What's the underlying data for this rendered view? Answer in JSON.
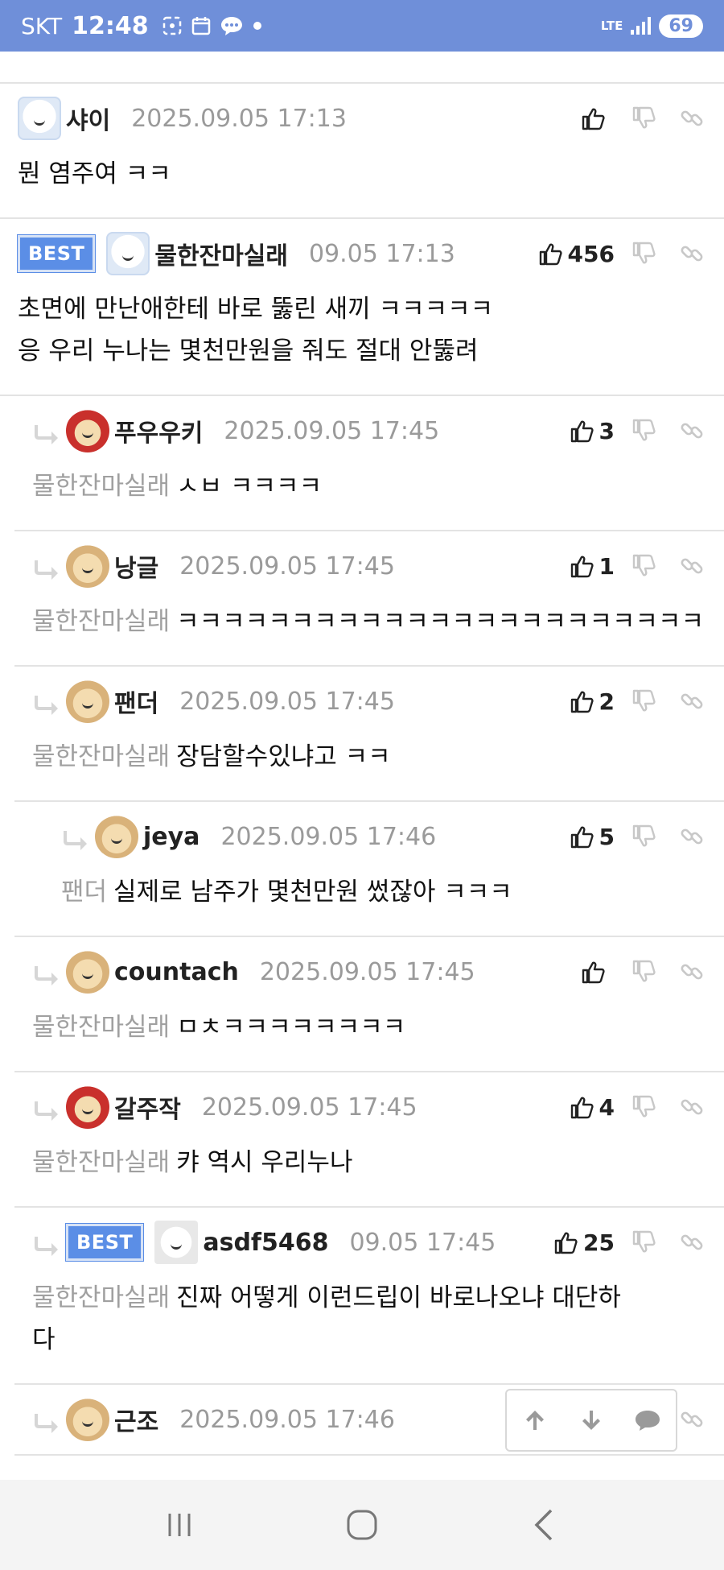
{
  "status_bar": {
    "carrier": "SKT",
    "time": "12:48",
    "network": "LTE",
    "battery": "69"
  },
  "comments": [
    {
      "nick": "샤이",
      "date": "2025.09.05 17:13",
      "likes": "",
      "best": false,
      "reply": false,
      "mention": "",
      "text": "뭔 염주여 ㅋㅋ",
      "avatar": "bear"
    },
    {
      "nick": "물한잔마실래",
      "date": "09.05 17:13",
      "likes": "456",
      "best": true,
      "best_label": "BEST",
      "reply": false,
      "mention": "",
      "text_lines": [
        "초면에 만난애한테 바로 뚫린 새끼 ㅋㅋㅋㅋㅋ",
        "응 우리 누나는 몇천만원을 줘도 절대 안뚫려"
      ],
      "avatar": "bear"
    },
    {
      "nick": "푸우우키",
      "date": "2025.09.05 17:45",
      "likes": "3",
      "best": false,
      "reply": true,
      "mention": "물한잔마실래",
      "text": "ㅅㅂ ㅋㅋㅋㅋ",
      "avatar": "red"
    },
    {
      "nick": "낭글",
      "date": "2025.09.05 17:45",
      "likes": "1",
      "best": false,
      "reply": true,
      "mention": "물한잔마실래",
      "text": "ㅋㅋㅋㅋㅋㅋㅋㅋㅋㅋㅋㅋㅋㅋㅋㅋㅋㅋㅋㅋㅋㅋㅋ",
      "avatar": "dog"
    },
    {
      "nick": "팬더",
      "date": "2025.09.05 17:45",
      "likes": "2",
      "best": false,
      "reply": true,
      "mention": "물한잔마실래",
      "text": "장담할수있냐고 ㅋㅋ",
      "avatar": "dog"
    },
    {
      "nick": "jeya",
      "date": "2025.09.05 17:46",
      "likes": "5",
      "best": false,
      "reply": true,
      "deep": true,
      "mention": "팬더",
      "text": "실제로 남주가 몇천만원 썼잖아 ㅋㅋㅋ",
      "avatar": "dog"
    },
    {
      "nick": "countach",
      "date": "2025.09.05 17:45",
      "likes": "",
      "best": false,
      "reply": true,
      "mention": "물한잔마실래",
      "text": "ㅁㅊㅋㅋㅋㅋㅋㅋㅋㅋ",
      "avatar": "dog"
    },
    {
      "nick": "갈주작",
      "date": "2025.09.05 17:45",
      "likes": "4",
      "best": false,
      "reply": true,
      "mention": "물한잔마실래",
      "text": "캬 역시 우리누나",
      "avatar": "red"
    },
    {
      "nick": "asdf5468",
      "date": "09.05 17:45",
      "likes": "25",
      "best": true,
      "best_label": "BEST",
      "reply": true,
      "mention": "물한잔마실래",
      "text_lines": [
        "진짜 어떻게 이런드립이 바로나오냐 대단하",
        "다"
      ],
      "avatar": "fox"
    },
    {
      "nick": "근조",
      "date": "2025.09.05 17:46",
      "likes": "",
      "best": false,
      "reply": true,
      "mention": "",
      "text": "",
      "avatar": "dog"
    }
  ],
  "icons": {
    "like": "thumbs-up-icon",
    "dislike": "thumbs-down-icon",
    "link": "link-icon",
    "scroll_up": "arrow-up-icon",
    "scroll_down": "arrow-down-icon",
    "comment": "comment-icon"
  },
  "colors": {
    "status_bar": "#6f8fd9",
    "best_badge": "#5b8ee6",
    "date": "#9a9a9a",
    "mention": "#a0a0a0"
  }
}
